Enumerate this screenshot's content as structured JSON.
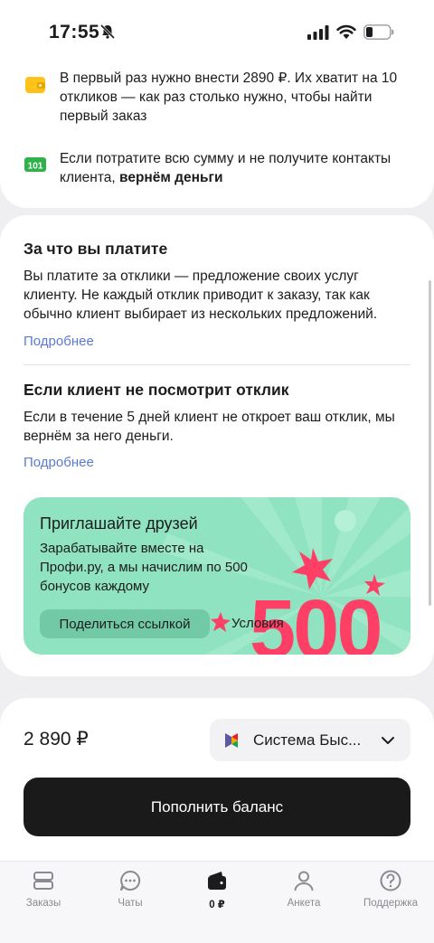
{
  "status_bar": {
    "time": "17:55"
  },
  "info": {
    "item1": "В первый раз нужно внести 2890 ₽. Их хватит на 10 откликов — как раз столько нужно, чтобы найти первый заказ",
    "item2_text": "Если потратите всю сумму и не получите контакты клиента, ",
    "item2_bold": "вернём деньги"
  },
  "section1": {
    "title": "За что вы платите",
    "text": "Вы платите за отклики — предложение своих услуг клиенту. Не каждый отклик приводит к заказу, так как обычно клиент выбирает из нескольких предложений.",
    "link": "Подробнее"
  },
  "section2": {
    "title": "Если клиент не посмотрит отклик",
    "text": "Если в течение 5 дней клиент не откроет ваш отклик, мы вернём за него деньги.",
    "link": "Подробнее"
  },
  "promo": {
    "title": "Приглашайте друзей",
    "text": "Зарабатывайте вместе на Профи.ру, а мы начислим по 500 бонусов каждому",
    "share_label": "Поделиться ссылкой",
    "conditions_label": "Условия",
    "big_number": "500",
    "accent_color": "#ff3f66",
    "bg_color": "#8fe3c0"
  },
  "payment": {
    "amount": "2 890 ₽",
    "method": "Система Быс...",
    "topup_label": "Пополнить баланс"
  },
  "tabs": [
    {
      "label": "Заказы",
      "icon": "orders-icon"
    },
    {
      "label": "Чаты",
      "icon": "chat-icon"
    },
    {
      "label": "0 ₽",
      "icon": "wallet-icon"
    },
    {
      "label": "Анкета",
      "icon": "profile-icon"
    },
    {
      "label": "Поддержка",
      "icon": "help-icon"
    }
  ]
}
